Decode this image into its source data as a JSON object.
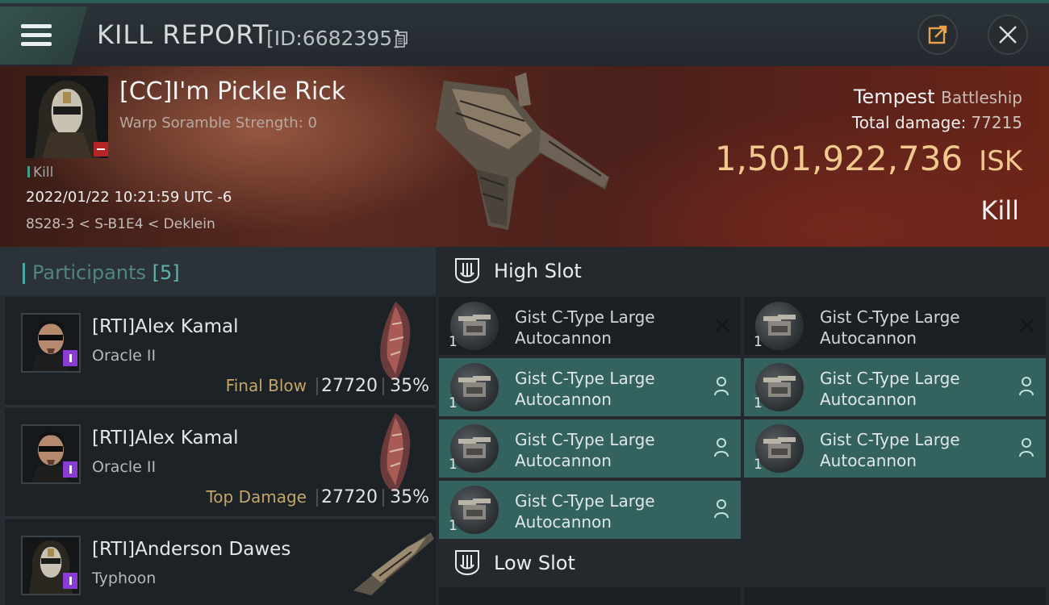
{
  "header": {
    "title": "KILL REPORT",
    "report_id": "[ID:6682395]"
  },
  "victim": {
    "name": "[CC]I'm Pickle Rick",
    "warp_scramble": "Warp Soramble Strength: 0",
    "tag": "Kill",
    "datetime": "2022/01/22 10:21:59 UTC -6",
    "location": "8S28-3 < S-B1E4 < Deklein",
    "ship_name": "Tempest",
    "ship_class": "Battleship",
    "total_damage_label": "Total damage:",
    "total_damage": "77215",
    "isk_value": "1,501,922,736",
    "isk_unit": "ISK",
    "result": "Kill"
  },
  "participants": {
    "title": "Participants",
    "count": "[5]",
    "items": [
      {
        "name": "[RTI]Alex Kamal",
        "ship": "Oracle II",
        "role": "Final Blow",
        "damage": "27720",
        "percent": "35%"
      },
      {
        "name": "[RTI]Alex Kamal",
        "ship": "Oracle II",
        "role": "Top Damage",
        "damage": "27720",
        "percent": "35%"
      },
      {
        "name": "[RTI]Anderson Dawes",
        "ship": "Typhoon",
        "role": "",
        "damage": "",
        "percent": ""
      }
    ]
  },
  "slots": {
    "high_title": "High Slot",
    "low_title": "Low Slot",
    "high": [
      {
        "line1": "Gist C-Type Large",
        "line2": "Autocannon",
        "qty": "1",
        "state": "destroyed"
      },
      {
        "line1": "Gist C-Type Large",
        "line2": "Autocannon",
        "qty": "1",
        "state": "destroyed"
      },
      {
        "line1": "Gist C-Type Large",
        "line2": "Autocannon",
        "qty": "1",
        "state": "dropped"
      },
      {
        "line1": "Gist C-Type Large",
        "line2": "Autocannon",
        "qty": "1",
        "state": "dropped"
      },
      {
        "line1": "Gist C-Type Large",
        "line2": "Autocannon",
        "qty": "1",
        "state": "dropped"
      },
      {
        "line1": "Gist C-Type Large",
        "line2": "Autocannon",
        "qty": "1",
        "state": "dropped"
      },
      {
        "line1": "Gist C-Type Large",
        "line2": "Autocannon",
        "qty": "1",
        "state": "dropped"
      }
    ]
  },
  "colors": {
    "accent": "#4aa9a6",
    "isk_gold": "#f1c98e",
    "fitted_bg": "#33625f",
    "role_gold": "#c4a56a"
  },
  "icons": [
    "menu-icon",
    "copy-icon",
    "share-icon",
    "close-icon",
    "high-slot-icon",
    "low-slot-icon",
    "autocannon-icon",
    "destroyed-x-icon",
    "pilot-icon"
  ]
}
